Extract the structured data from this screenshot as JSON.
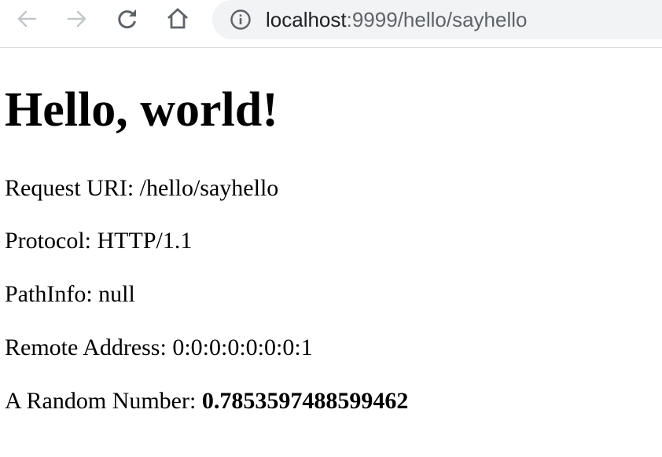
{
  "browser": {
    "url_host": "localhost",
    "url_rest": ":9999/hello/sayhello",
    "icons": {
      "back": "arrow-left",
      "forward": "arrow-right",
      "reload": "reload",
      "home": "home",
      "site_info": "info-circle"
    }
  },
  "page": {
    "heading": "Hello, world!",
    "request_uri_label": "Request URI: ",
    "request_uri_value": "/hello/sayhello",
    "protocol_label": "Protocol: ",
    "protocol_value": "HTTP/1.1",
    "pathinfo_label": "PathInfo: ",
    "pathinfo_value": "null",
    "remote_address_label": "Remote Address: ",
    "remote_address_value": "0:0:0:0:0:0:0:1",
    "random_number_label": "A Random Number: ",
    "random_number_value": "0.7853597488599462"
  }
}
